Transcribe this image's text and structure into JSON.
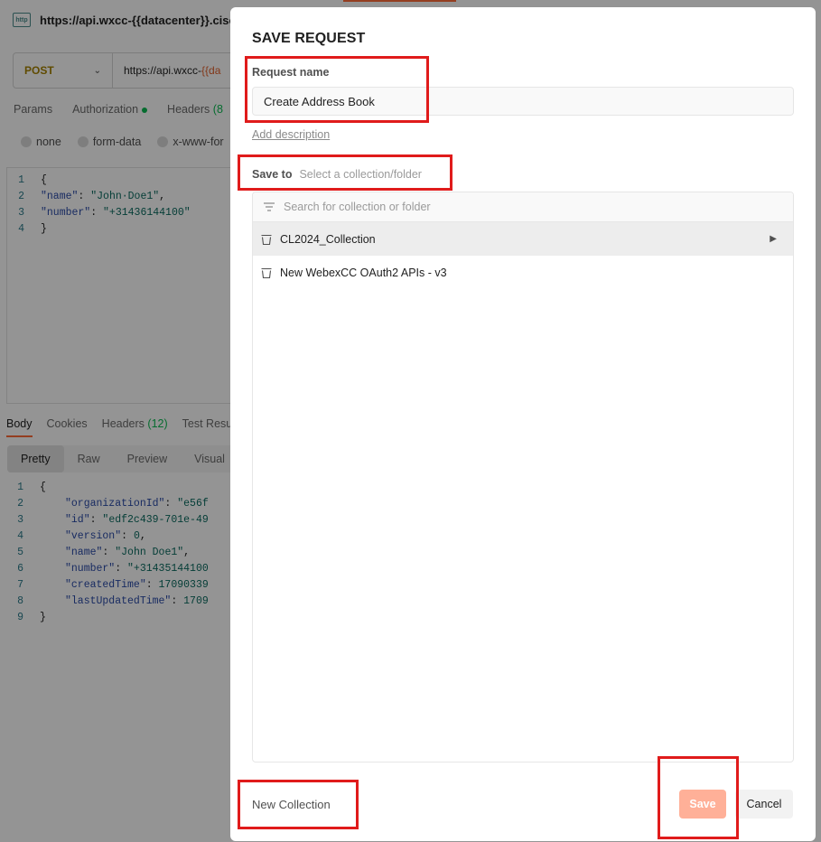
{
  "background": {
    "request_url_title": "https://api.wxcc-{{datacenter}}.cisc",
    "http_icon": "http",
    "method": "POST",
    "url_prefix": "https://api.wxcc-",
    "url_var": "{{da",
    "request_tabs": {
      "params": "Params",
      "authorization": "Authorization",
      "headers": "Headers",
      "headers_count": "(8"
    },
    "body_types": [
      "none",
      "form-data",
      "x-www-for"
    ],
    "request_body": [
      {
        "n": "1",
        "text": "{"
      },
      {
        "n": "2",
        "key": "\"name\"",
        "sep": ": ",
        "val": "\"John·Doe1\"",
        "end": ","
      },
      {
        "n": "3",
        "key": "\"number\"",
        "sep": ": ",
        "val": "\"+31436144100\"",
        "end": ""
      },
      {
        "n": "4",
        "text": "}"
      }
    ],
    "response_tabs": {
      "body": "Body",
      "cookies": "Cookies",
      "headers": "Headers",
      "headers_count": "(12)",
      "test_results": "Test Resu"
    },
    "view_tabs": [
      "Pretty",
      "Raw",
      "Preview",
      "Visual"
    ],
    "response_body": [
      {
        "n": "1",
        "text": "{"
      },
      {
        "n": "2",
        "key": "\"organizationId\"",
        "sep": ": ",
        "val": "\"e56f",
        "end": ""
      },
      {
        "n": "3",
        "key": "\"id\"",
        "sep": ": ",
        "val": "\"edf2c439-701e-49",
        "end": ""
      },
      {
        "n": "4",
        "key": "\"version\"",
        "sep": ": ",
        "val": "0",
        "end": ","
      },
      {
        "n": "5",
        "key": "\"name\"",
        "sep": ": ",
        "val": "\"John Doe1\"",
        "end": ","
      },
      {
        "n": "6",
        "key": "\"number\"",
        "sep": ": ",
        "val": "\"+31435144100",
        "end": ""
      },
      {
        "n": "7",
        "key": "\"createdTime\"",
        "sep": ": ",
        "val": "17090339",
        "end": ""
      },
      {
        "n": "8",
        "key": "\"lastUpdatedTime\"",
        "sep": ": ",
        "val": "1709",
        "end": ""
      },
      {
        "n": "9",
        "text": "}"
      }
    ]
  },
  "modal": {
    "title": "SAVE REQUEST",
    "request_name_label": "Request name",
    "request_name_value": "Create Address Book",
    "add_description": "Add description",
    "save_to_label": "Save to",
    "save_to_placeholder": "Select a collection/folder",
    "search_placeholder": "Search for collection or folder",
    "collections": [
      {
        "label": "CL2024_Collection",
        "icon": "collection-icon",
        "selected": true,
        "has_children": true
      },
      {
        "label": "New WebexCC OAuth2 APIs - v3",
        "icon": "collection-icon",
        "selected": false,
        "has_children": false
      }
    ],
    "new_collection": "New Collection",
    "save_button": "Save",
    "cancel_button": "Cancel"
  },
  "colors": {
    "accent": "#ff6c37",
    "save_disabled": "#ffb098",
    "annotation": "#e01b1b",
    "post_method": "#a68200"
  }
}
